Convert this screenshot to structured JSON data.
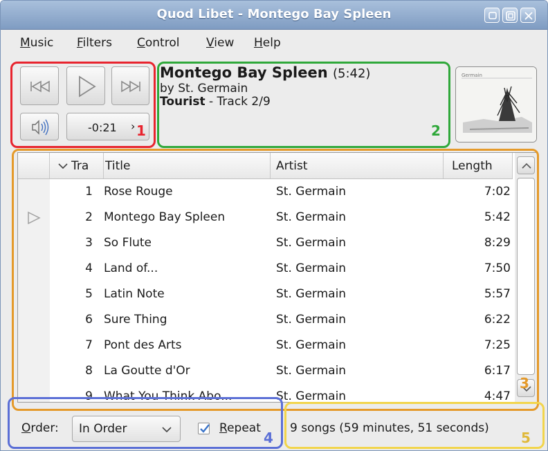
{
  "window": {
    "title": "Quod Libet - Montego Bay Spleen"
  },
  "menu": [
    {
      "mnemonic": "M",
      "rest": "usic"
    },
    {
      "mnemonic": "F",
      "rest": "ilters"
    },
    {
      "mnemonic": "C",
      "rest": "ontrol"
    },
    {
      "mnemonic": "V",
      "rest": "iew"
    },
    {
      "mnemonic": "H",
      "rest": "elp"
    }
  ],
  "controls": {
    "position": "-0:21",
    "seek_arrow": "›"
  },
  "now_playing": {
    "title": "Montego Bay Spleen",
    "length": "(5:42)",
    "by_line": "by St. Germain",
    "album": "Tourist",
    "track_info": " - Track 2/9"
  },
  "album_art": {
    "label": "Germain"
  },
  "song_list": {
    "columns": {
      "track": "Tra",
      "title": "Title",
      "artist": "Artist",
      "length": "Length"
    },
    "rows": [
      {
        "num": "1",
        "title": "Rose Rouge",
        "artist": "St. Germain",
        "length": "7:02"
      },
      {
        "num": "2",
        "title": "Montego Bay Spleen",
        "artist": "St. Germain",
        "length": "5:42"
      },
      {
        "num": "3",
        "title": "So Flute",
        "artist": "St. Germain",
        "length": "8:29"
      },
      {
        "num": "4",
        "title": "Land of...",
        "artist": "St. Germain",
        "length": "7:50"
      },
      {
        "num": "5",
        "title": "Latin Note",
        "artist": "St. Germain",
        "length": "5:57"
      },
      {
        "num": "6",
        "title": "Sure Thing",
        "artist": "St. Germain",
        "length": "6:22"
      },
      {
        "num": "7",
        "title": "Pont des Arts",
        "artist": "St. Germain",
        "length": "7:25"
      },
      {
        "num": "8",
        "title": "La Goutte d'Or",
        "artist": "St. Germain",
        "length": "6:17"
      },
      {
        "num": "9",
        "title": "What You Think Abo...",
        "artist": "St. Germain",
        "length": "4:47"
      }
    ]
  },
  "bottom": {
    "order_label_mnemonic": "O",
    "order_label_rest": "rder:",
    "order_value": "In Order",
    "repeat_mnemonic": "R",
    "repeat_rest": "epeat",
    "repeat_checked": true,
    "status": "9 songs (59 minutes, 51 seconds)"
  },
  "annotations": {
    "labels": [
      "1",
      "2",
      "3",
      "4",
      "5"
    ],
    "colors": [
      "#e8242e",
      "#2fa83a",
      "#e59a2a",
      "#5b6fd6",
      "#f2d54c"
    ]
  },
  "colors": {
    "titlebar": "#8fa9cc",
    "background": "#ececec",
    "list_bg": "#ffffff"
  }
}
